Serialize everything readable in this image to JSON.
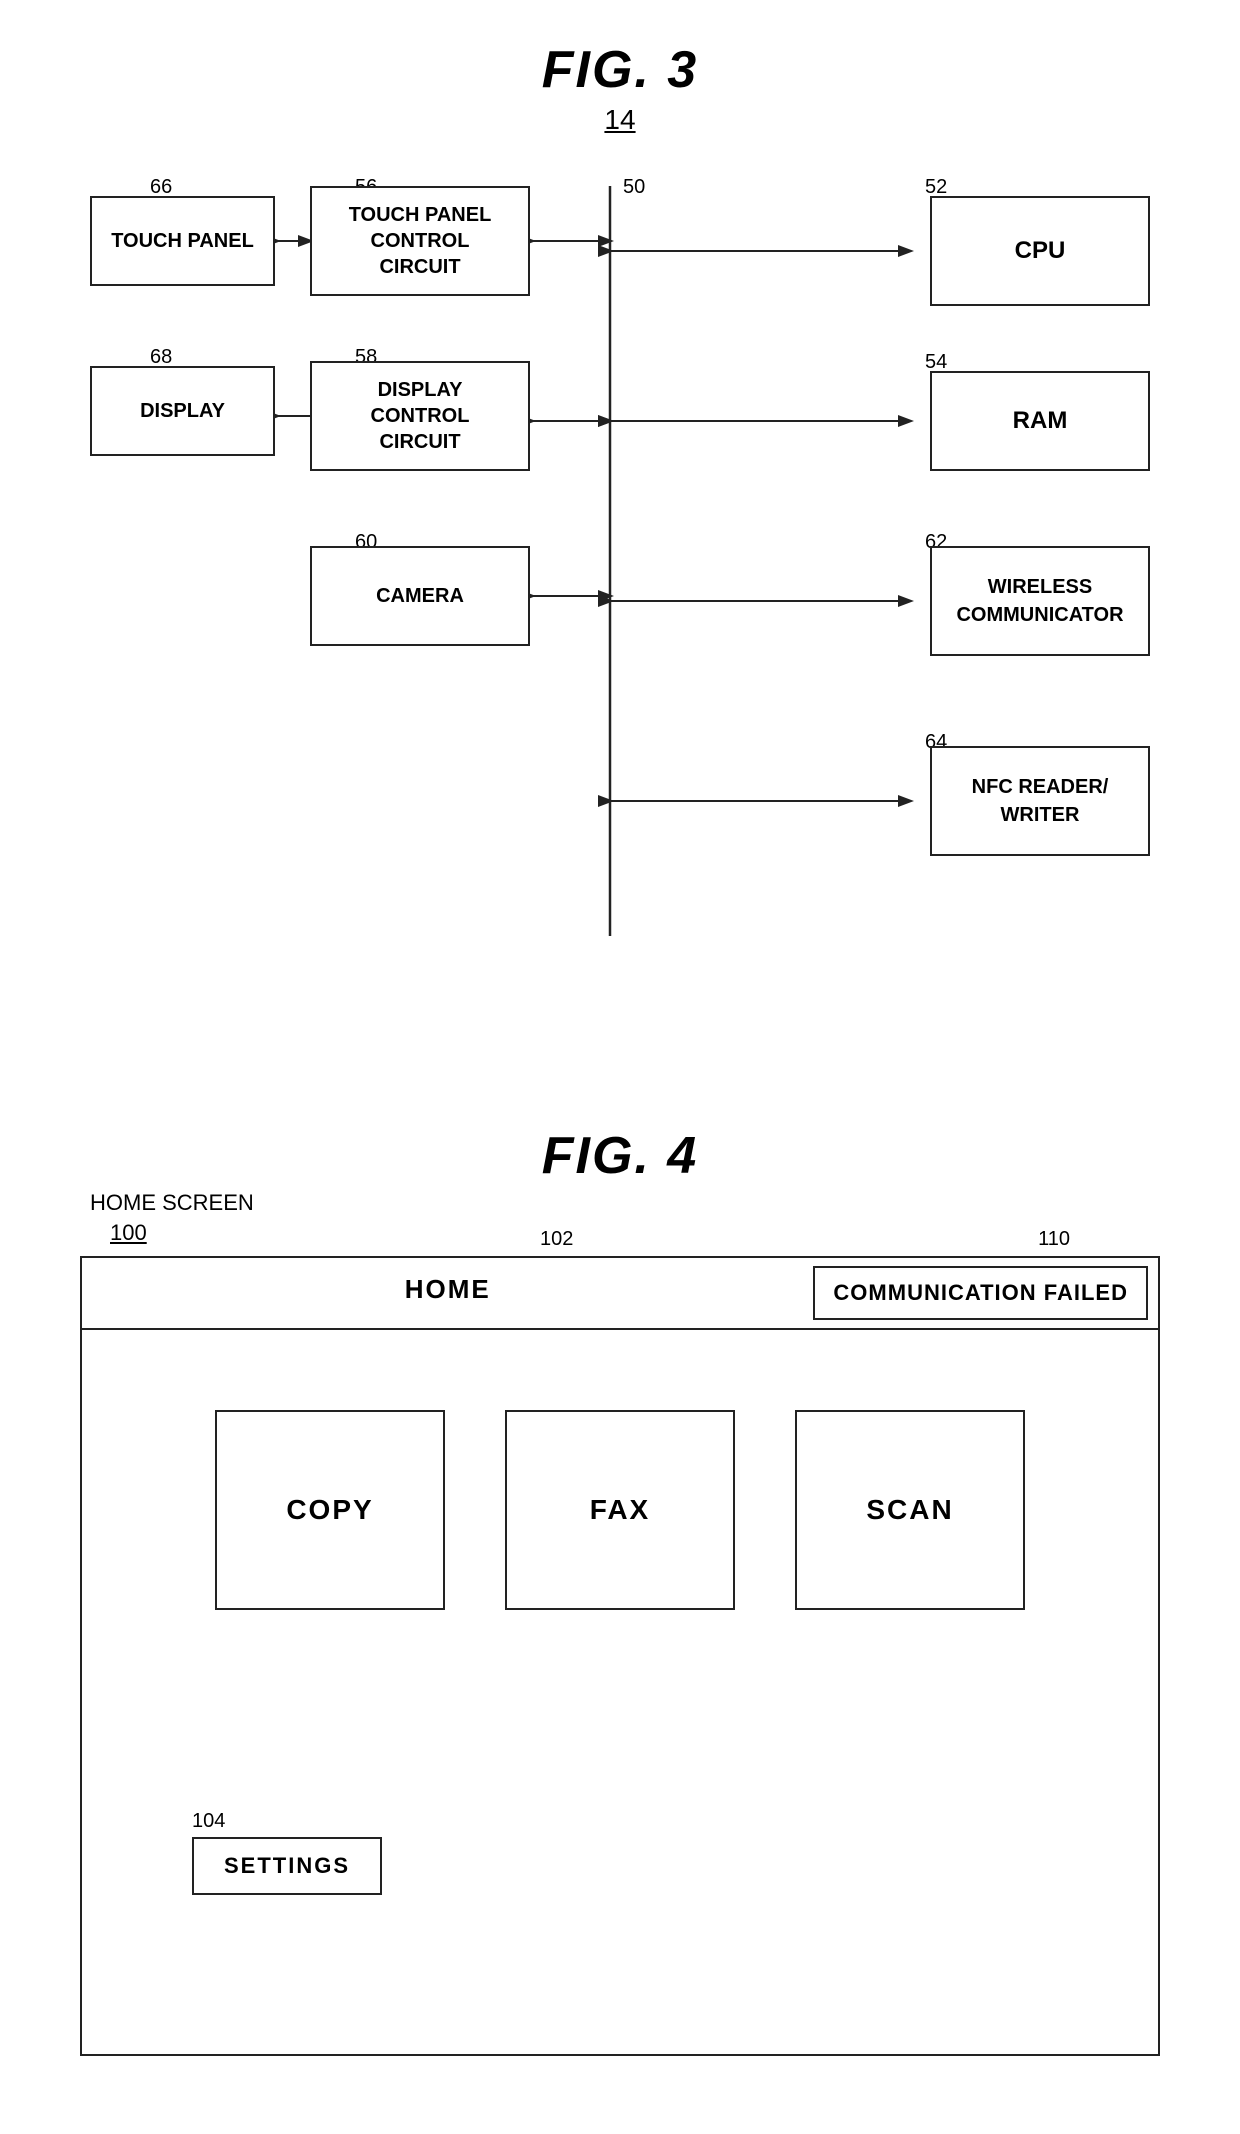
{
  "fig3": {
    "title": "FIG. 3",
    "ref": "14",
    "bus_ref": "50",
    "blocks": {
      "touch_panel": {
        "label": "TOUCH PANEL",
        "ref": "66"
      },
      "touch_ctrl": {
        "label": "TOUCH PANEL\nCONTROL\nCIRCUIT",
        "ref": "56"
      },
      "display": {
        "label": "DISPLAY",
        "ref": "68"
      },
      "display_ctrl": {
        "label": "DISPLAY\nCONTROL\nCIRCUIT",
        "ref": "58"
      },
      "camera": {
        "label": "CAMERA",
        "ref": "60"
      },
      "cpu": {
        "label": "CPU",
        "ref": "52"
      },
      "ram": {
        "label": "RAM",
        "ref": "54"
      },
      "wireless": {
        "label": "WIRELESS\nCOMMUNICATOR",
        "ref": "62"
      },
      "nfc": {
        "label": "NFC READER/\nWRITER",
        "ref": "64"
      }
    }
  },
  "fig4": {
    "title": "FIG. 4",
    "screen_label": "HOME SCREEN",
    "screen_ref": "100",
    "header_ref": "102",
    "comm_failed_ref": "110",
    "home_title": "HOME",
    "comm_failed_label": "COMMUNICATION FAILED",
    "buttons": [
      {
        "label": "COPY",
        "ref": ""
      },
      {
        "label": "FAX",
        "ref": ""
      },
      {
        "label": "SCAN",
        "ref": ""
      }
    ],
    "settings_ref": "104",
    "settings_label": "SETTINGS"
  }
}
